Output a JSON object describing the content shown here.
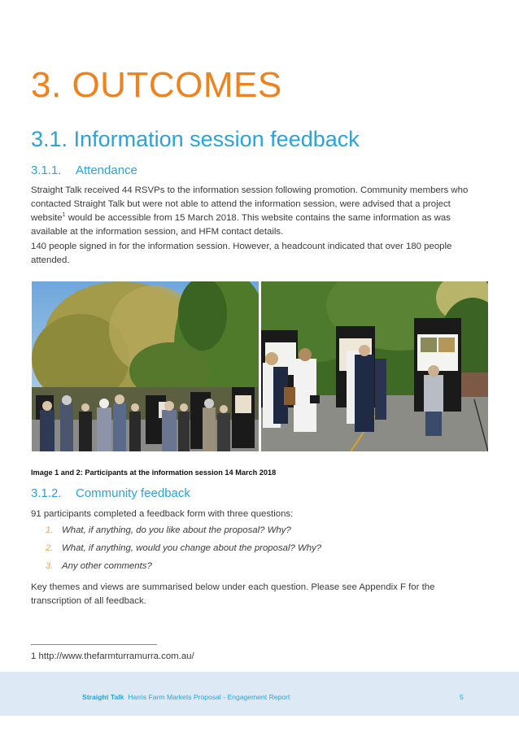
{
  "heading": {
    "number": "3.",
    "title": "OUTCOMES"
  },
  "section": {
    "number": "3.1.",
    "title": "Information session feedback"
  },
  "attendance": {
    "number": "3.1.1.",
    "title": "Attendance",
    "para1_before_sup": "Straight Talk received 44 RSVPs to the information session following promotion. Community members who contacted Straight Talk but were not able to attend the information session, were advised that a project website",
    "para1_sup": "1",
    "para1_after_sup": " would be accessible from 15 March 2018. This website contains the same information as was available at the information session, and HFM contact details.",
    "para2": "140 people signed in for the information session. However, a headcount indicated that over 180 people attended."
  },
  "images": {
    "photo1_alt": "Participants gathered outdoors under trees viewing display boards",
    "photo2_alt": "Participants viewing display boards in a car park",
    "caption": "Image 1 and 2: Participants at the information session 14 March 2018"
  },
  "community_feedback": {
    "number": "3.1.2.",
    "title": "Community feedback",
    "intro": "91 participants completed a feedback form with three questions:",
    "questions": [
      {
        "num": "1.",
        "text": "What, if anything, do you like about the proposal? Why?"
      },
      {
        "num": "2.",
        "text": "What, if anything, would you change about the proposal? Why?"
      },
      {
        "num": "3.",
        "text": "Any other comments?"
      }
    ],
    "closing": "Key themes and views are summarised below under each question. Please see Appendix F for the transcription of all feedback."
  },
  "footnote": {
    "text": "1 http://www.thefarmturramurra.com.au/"
  },
  "footer": {
    "brand": "Straight Talk",
    "title": "Harris Farm Markets Proposal - Engagement Report",
    "page": "5"
  },
  "colors": {
    "heading_orange": "#f0821e",
    "heading_blue": "#2aa3dc",
    "list_number_orange": "#f5a25a",
    "footer_band": "#dde9f5"
  }
}
